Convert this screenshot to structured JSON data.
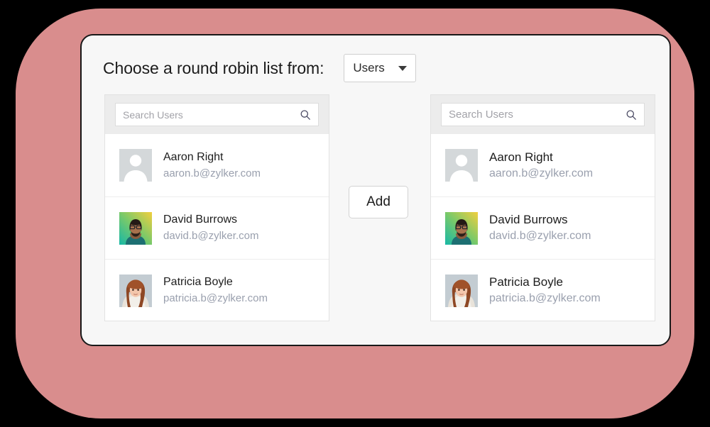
{
  "theme": {
    "frame_color": "#d98d8d",
    "card_background": "#f7f7f7",
    "card_border": "#191919",
    "panel_header": "#ececec",
    "muted_text": "#9aa0ae",
    "page_background": "#000000"
  },
  "header": {
    "title": "Choose a round robin list from:",
    "source_select": {
      "value": "Users",
      "icon": "chevron-down-icon"
    }
  },
  "panels": {
    "source": {
      "search": {
        "placeholder": "Search Users",
        "value": "",
        "icon": "search-icon"
      },
      "users": [
        {
          "name": "Aaron Right",
          "email": "aaron.b@zylker.com",
          "avatar": "placeholder-silhouette"
        },
        {
          "name": "David Burrows",
          "email": "david.b@zylker.com",
          "avatar": "photo-david"
        },
        {
          "name": "Patricia Boyle",
          "email": "patricia.b@zylker.com",
          "avatar": "photo-patricia"
        }
      ]
    },
    "target": {
      "search": {
        "placeholder": "Search Users",
        "value": "",
        "icon": "search-icon"
      },
      "users": [
        {
          "name": "Aaron Right",
          "email": "aaron.b@zylker.com",
          "avatar": "placeholder-silhouette"
        },
        {
          "name": "David Burrows",
          "email": "david.b@zylker.com",
          "avatar": "photo-david"
        },
        {
          "name": "Patricia Boyle",
          "email": "patricia.b@zylker.com",
          "avatar": "photo-patricia"
        }
      ]
    }
  },
  "actions": {
    "add_label": "Add"
  }
}
